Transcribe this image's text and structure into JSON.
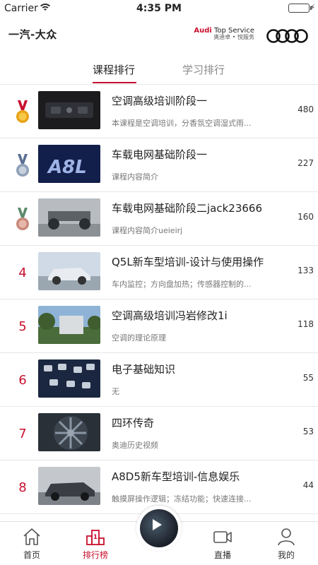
{
  "status_bar": {
    "carrier": "Carrier",
    "time": "4:35 PM"
  },
  "brand": {
    "faw_logo": "一汽-大众",
    "audi_en_brand": "Audi",
    "audi_en_service": " Top Service",
    "audi_cn": "奥迪卓 • 悦服务"
  },
  "tabs": [
    {
      "label": "课程排行",
      "active": true
    },
    {
      "label": "学习排行",
      "active": false
    }
  ],
  "ranking": [
    {
      "rank": "1",
      "medal": "gold",
      "title": "空调高级培训阶段一",
      "desc": "本课程是空调培训，分香氛空调湿式雨...",
      "count": "480"
    },
    {
      "rank": "2",
      "medal": "silver",
      "title": "车载电网基础阶段一",
      "desc": "课程内容简介",
      "count": "227"
    },
    {
      "rank": "3",
      "medal": "bronze",
      "title": "车载电网基础阶段二jack23666",
      "desc": "课程内容简介ueieirj",
      "count": "160"
    },
    {
      "rank": "4",
      "title": "Q5L新车型培训-设计与使用操作",
      "desc": "车内监控；方向盘加热；传感器控制的...",
      "count": "133"
    },
    {
      "rank": "5",
      "title": "空调高级培训冯岩修改1i",
      "desc": "空调的理论原理",
      "count": "118"
    },
    {
      "rank": "6",
      "title": "电子基础知识",
      "desc": "无",
      "count": "55"
    },
    {
      "rank": "7",
      "title": "四环传奇",
      "desc": "奥迪历史视频",
      "count": "53"
    },
    {
      "rank": "8",
      "title": "A8D5新车型培训-信息娱乐",
      "desc": "触摸屏操作逻辑；冻结功能；快速连接...",
      "count": "44"
    }
  ],
  "bottom_nav": [
    {
      "label": "首页",
      "icon": "home-icon"
    },
    {
      "label": "排行榜",
      "icon": "podium-icon",
      "active": true
    },
    {
      "label": "直播",
      "icon": "video-camera-icon"
    },
    {
      "label": "我的",
      "icon": "user-icon"
    }
  ],
  "colors": {
    "accent": "#c8102e",
    "gold": "#e8a317",
    "silver": "#8fa0b8",
    "bronze": "#c98a7a"
  }
}
